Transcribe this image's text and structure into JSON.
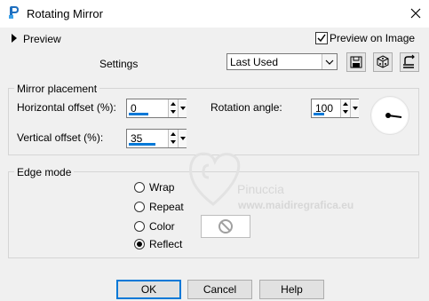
{
  "window": {
    "title": "Rotating Mirror"
  },
  "preview": {
    "label": "Preview",
    "preview_on_image_label": "Preview on Image",
    "preview_on_image_checked": true
  },
  "settings": {
    "label": "Settings",
    "preset_value": "Last Used"
  },
  "mirror_placement": {
    "title": "Mirror placement",
    "horizontal_offset": {
      "label": "Horizontal offset (%):",
      "value": "0",
      "level_fraction": 0.5
    },
    "vertical_offset": {
      "label": "Vertical offset (%):",
      "value": "35",
      "level_fraction": 0.675
    },
    "rotation_angle": {
      "label": "Rotation angle:",
      "value": "100",
      "level_fraction": 0.28
    }
  },
  "edge_mode": {
    "title": "Edge mode",
    "options": [
      {
        "label": "Wrap",
        "selected": false
      },
      {
        "label": "Repeat",
        "selected": false
      },
      {
        "label": "Color",
        "selected": false
      },
      {
        "label": "Reflect",
        "selected": true
      }
    ]
  },
  "buttons": {
    "ok": "OK",
    "cancel": "Cancel",
    "help": "Help"
  },
  "watermark": {
    "name": "Pinuccia",
    "url": "www.maidiregrafica.eu"
  },
  "colors": {
    "accent": "#0078d7",
    "window_bg": "#f0f0f0",
    "titlebar_bg": "#ffffff"
  }
}
